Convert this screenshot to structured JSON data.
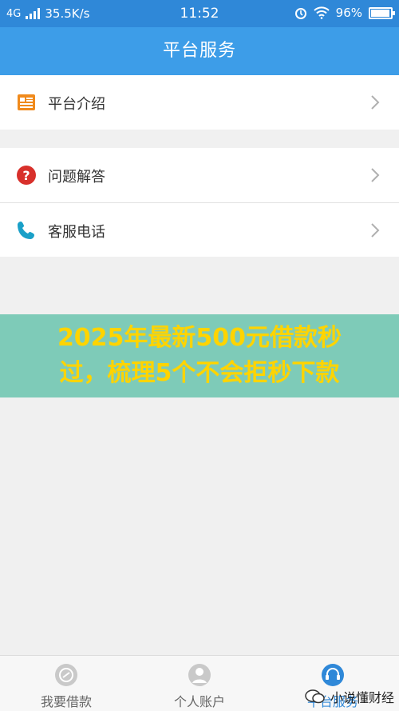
{
  "status_bar": {
    "network": "4G",
    "speed": "35.5K/s",
    "time": "11:52",
    "battery": "96%",
    "battery_level": 0.96
  },
  "header": {
    "title": "平台服务"
  },
  "menu": {
    "intro": "平台介绍",
    "faq": "问题解答",
    "phone": "客服电话"
  },
  "banner": {
    "line1": "2025年最新500元借款秒",
    "line2": "过，梳理5个不会拒秒下款"
  },
  "tabs": {
    "loan": "我要借款",
    "account": "个人账户",
    "service": "平台服务"
  },
  "watermark": {
    "text": "小说懂财经"
  },
  "colors": {
    "header_bg": "#3d9de8",
    "status_bg": "#2f88d8",
    "banner_bg": "#7ecbb8",
    "banner_text": "#ffd400",
    "active_tab": "#2f88d8"
  },
  "icons": {
    "intro": "document-icon",
    "faq": "question-icon",
    "phone": "phone-icon"
  }
}
